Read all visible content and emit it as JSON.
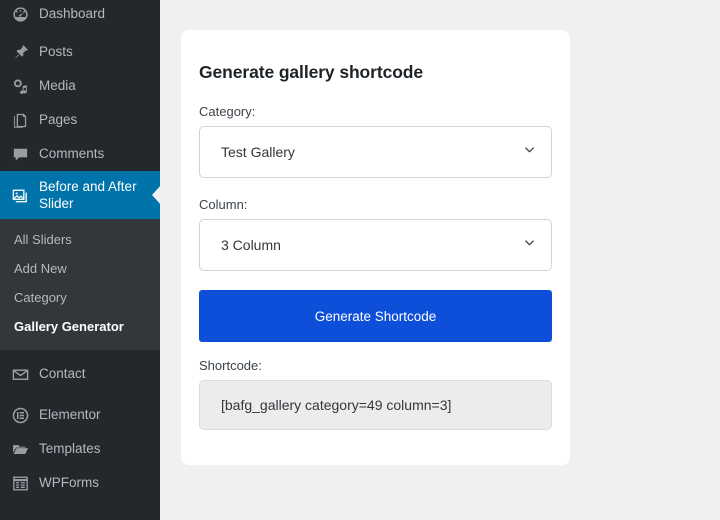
{
  "sidebar": {
    "items": [
      {
        "label": "Dashboard",
        "icon": "dashboard-icon",
        "current": false
      },
      {
        "label": "Posts",
        "icon": "pin-icon",
        "current": false
      },
      {
        "label": "Media",
        "icon": "media-icon",
        "current": false
      },
      {
        "label": "Pages",
        "icon": "pages-icon",
        "current": false
      },
      {
        "label": "Comments",
        "icon": "comments-icon",
        "current": false
      },
      {
        "label": "Before and After Slider",
        "icon": "images-icon",
        "current": true
      },
      {
        "label": "Contact",
        "icon": "envelope-icon",
        "current": false
      },
      {
        "label": "Elementor",
        "icon": "elementor-icon",
        "current": false
      },
      {
        "label": "Templates",
        "icon": "folder-icon",
        "current": false
      },
      {
        "label": "WPForms",
        "icon": "wpforms-icon",
        "current": false
      }
    ],
    "submenu": [
      {
        "label": "All Sliders",
        "current": false
      },
      {
        "label": "Add New",
        "current": false
      },
      {
        "label": "Category",
        "current": false
      },
      {
        "label": "Gallery Generator",
        "current": true
      }
    ],
    "colors": {
      "background": "#23282d",
      "submenu_background": "#32373c",
      "current_background": "#0073aa",
      "text": "#b4b9be"
    }
  },
  "main": {
    "card": {
      "title": "Generate gallery shortcode",
      "category": {
        "label": "Category:",
        "value": "Test Gallery",
        "icon": "chevron-down-icon"
      },
      "column": {
        "label": "Column:",
        "value": "3 Column",
        "icon": "chevron-down-icon"
      },
      "generate_button": {
        "label": "Generate Shortcode",
        "color": "#0d4fd8"
      },
      "shortcode": {
        "label": "Shortcode:",
        "value": "[bafg_gallery category=49 column=3]"
      }
    },
    "background": "#f0f0f1"
  }
}
